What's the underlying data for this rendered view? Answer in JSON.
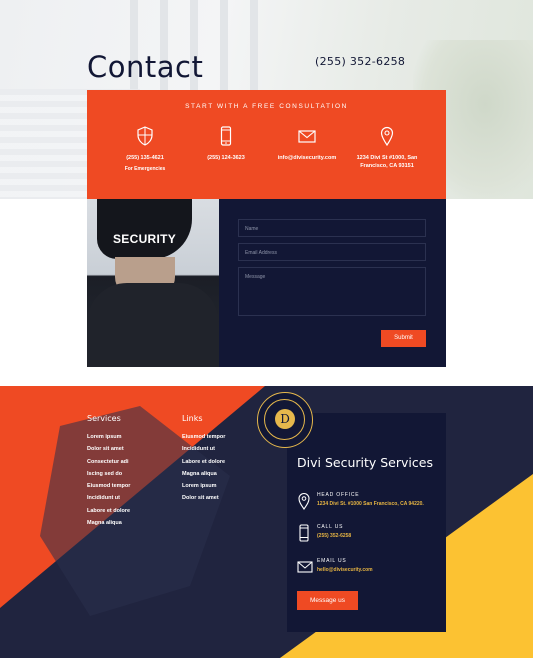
{
  "hero": {
    "title": "Contact",
    "phone": "(255) 352-6258"
  },
  "info_box": {
    "kicker": "Start With a Free Consultation",
    "items": [
      {
        "icon": "shield-icon",
        "main": "(255) 135-4621",
        "sub": "For Emergencies"
      },
      {
        "icon": "mobile-phone-icon",
        "main": "(255) 124-3623",
        "sub": ""
      },
      {
        "icon": "envelope-icon",
        "main": "info@divisecurity.com",
        "sub": ""
      },
      {
        "icon": "map-pin-icon",
        "main": "1234 Divi St #1000, San Francisco, CA 93151",
        "sub": ""
      }
    ]
  },
  "guard_photo": {
    "cap_text": "SECURITY"
  },
  "form": {
    "name_placeholder": "Name",
    "email_placeholder": "Email Address",
    "message_placeholder": "Message",
    "submit_label": "Submit"
  },
  "footer": {
    "services": {
      "heading": "Services",
      "links": [
        "Lorem ipsum",
        "Dolor sit amet",
        "Consectetur adi",
        "Iscing sed do",
        "Eiusmod tempor",
        "Incididunt ut",
        "Labore et dolore",
        "Magna aliqua"
      ]
    },
    "links": {
      "heading": "Links",
      "links": [
        "Eiusmod tempor",
        "Incididunt ut",
        "Labore et dolore",
        "Magna aliqua",
        "Lorem ipsum",
        "Dolor sit amet"
      ]
    },
    "badge_letter": "D",
    "card": {
      "title": "Divi Security Services",
      "items": [
        {
          "icon": "map-pin-icon",
          "label": "Head Office",
          "value": "1234 Divi St. #1000 San Francisco, CA 94220."
        },
        {
          "icon": "mobile-phone-icon",
          "label": "Call Us",
          "value": "(255) 352-6258"
        },
        {
          "icon": "envelope-icon",
          "label": "Email Us",
          "value": "hello@divisecurity.com"
        }
      ],
      "button_label": "Message us"
    }
  },
  "colors": {
    "accent_orange": "#ef4a23",
    "navy": "#121735",
    "gold": "#e7b543",
    "yellow": "#fcc232"
  }
}
